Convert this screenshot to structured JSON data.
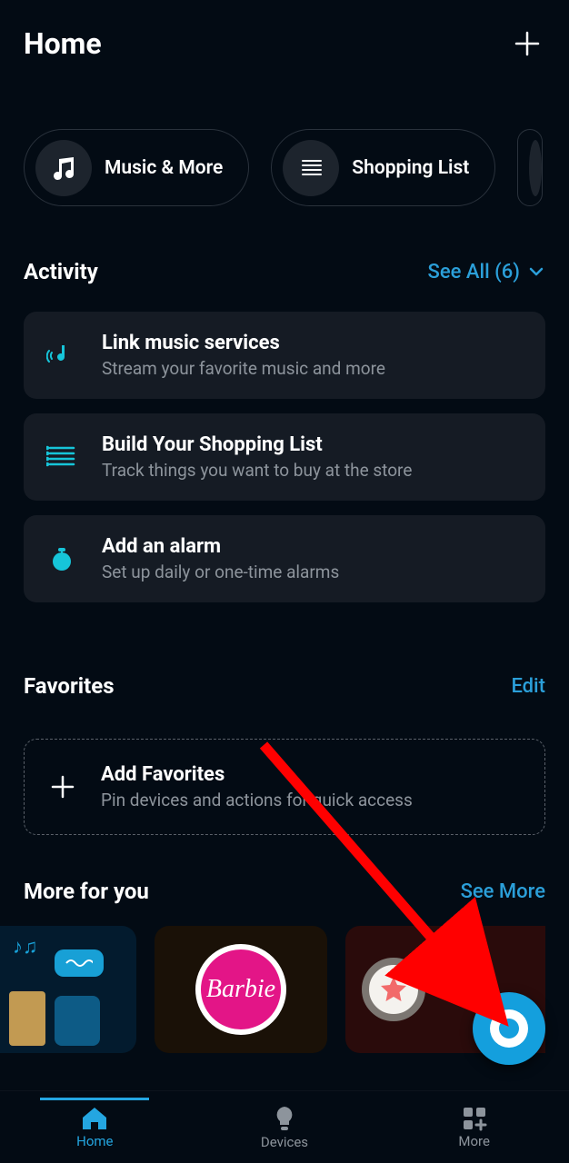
{
  "header": {
    "title": "Home"
  },
  "chips": [
    {
      "icon": "music-note-icon",
      "label": "Music & More"
    },
    {
      "icon": "list-icon",
      "label": "Shopping List"
    }
  ],
  "activity": {
    "heading": "Activity",
    "see_all_label": "See All (6)",
    "cards": [
      {
        "icon": "music-broadcast-icon",
        "title": "Link music services",
        "subtitle": "Stream your favorite music and more"
      },
      {
        "icon": "list-lines-icon",
        "title": "Build Your Shopping List",
        "subtitle": "Track things you want to buy at the store"
      },
      {
        "icon": "alarm-clock-icon",
        "title": "Add an alarm",
        "subtitle": "Set up daily or one-time alarms"
      }
    ]
  },
  "favorites": {
    "heading": "Favorites",
    "edit_label": "Edit",
    "add_title": "Add Favorites",
    "add_subtitle": "Pin devices and actions for quick access"
  },
  "more_for_you": {
    "heading": "More for you",
    "see_more_label": "See More",
    "cards": [
      {
        "kind": "alexa-devices-promo"
      },
      {
        "kind": "barbie-promo",
        "label": "Barbie"
      },
      {
        "kind": "star-promo"
      }
    ]
  },
  "fab": {
    "name": "alexa-voice-button"
  },
  "tabs": [
    {
      "icon": "home-icon",
      "label": "Home",
      "active": true
    },
    {
      "icon": "bulb-icon",
      "label": "Devices",
      "active": false
    },
    {
      "icon": "grid-plus-icon",
      "label": "More",
      "active": false
    }
  ],
  "colors": {
    "accent": "#24a6e1",
    "link": "#2b9fd9",
    "card": "#151b24"
  }
}
